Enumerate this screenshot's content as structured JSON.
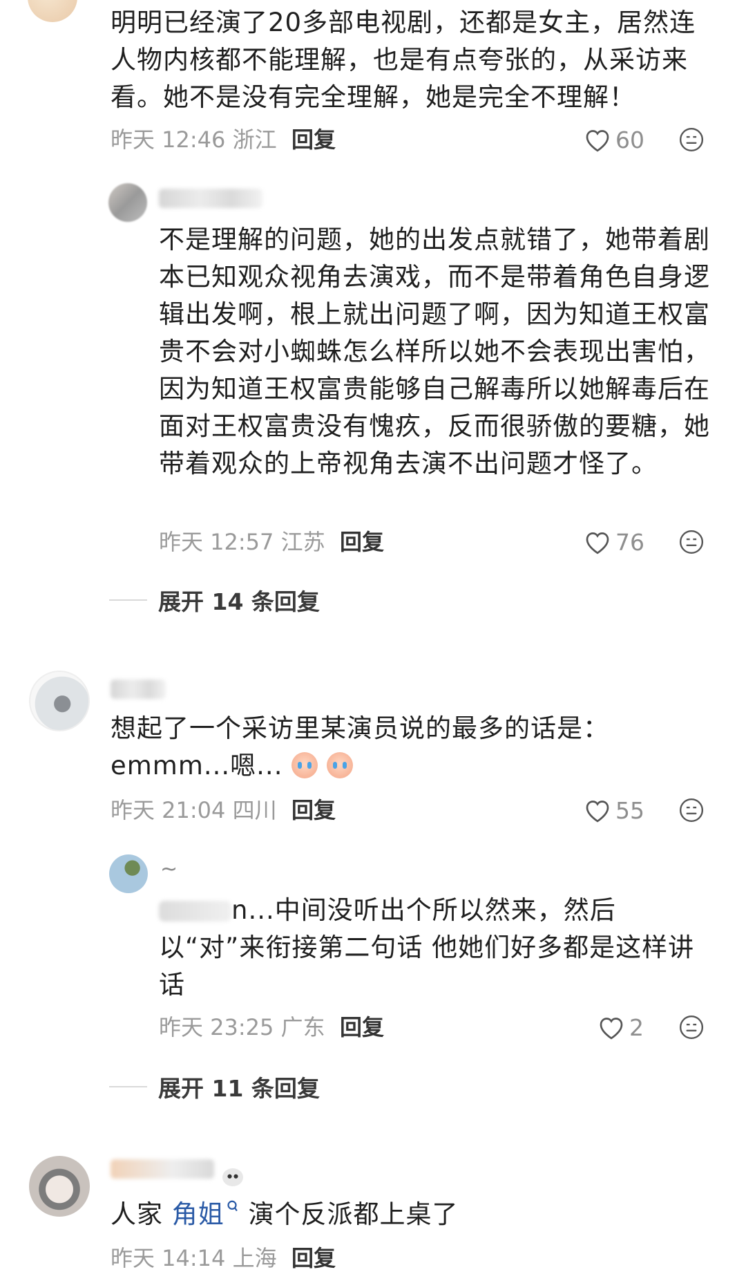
{
  "comments": [
    {
      "text": "明明已经演了20多部电视剧，还都是女主，居然连人物内核都不能理解，也是有点夸张的，从采访来看。她不是没有完全理解，她是完全不理解！",
      "meta": "昨天 12:46 浙江",
      "reply_label": "回复",
      "likes": "60",
      "replies": [
        {
          "text": "不是理解的问题，她的出发点就错了，她带着剧本已知观众视角去演戏，而不是带着角色自身逻辑出发啊，根上就出问题了啊，因为知道王权富贵不会对小蜘蛛怎么样所以她不会表现出害怕，因为知道王权富贵能够自己解毒所以她解毒后在面对王权富贵没有愧疚，反而很骄傲的要糖，她带着观众的上帝视角去演不出问题才怪了。",
          "meta": "昨天 12:57 江苏",
          "reply_label": "回复",
          "likes": "76"
        }
      ],
      "expand": "展开 14 条回复"
    },
    {
      "text": "想起了一个采访里某演员说的最多的话是：emmm...嗯...",
      "meta": "昨天 21:04 四川",
      "reply_label": "回复",
      "likes": "55",
      "replies": [
        {
          "name_suffix": "~",
          "text_prefix": "n...",
          "text": "中间没听出个所以然来，然后以“对”来衔接第二句话 他她们好多都是这样讲话",
          "meta": "昨天 23:25 广东",
          "reply_label": "回复",
          "likes": "2"
        }
      ],
      "expand": "展开 11 条回复"
    },
    {
      "text_before": "人家 ",
      "mention": "角姐",
      "text_after": " 演个反派都上桌了",
      "meta": "昨天 14:14 上海",
      "reply_label": "回复"
    }
  ],
  "colors": {
    "text": "#1f1f1f",
    "meta": "#9a9a9a",
    "mention": "#2a5aa6"
  },
  "icons": [
    "heart-icon",
    "emoji-icon",
    "mention-icon"
  ]
}
